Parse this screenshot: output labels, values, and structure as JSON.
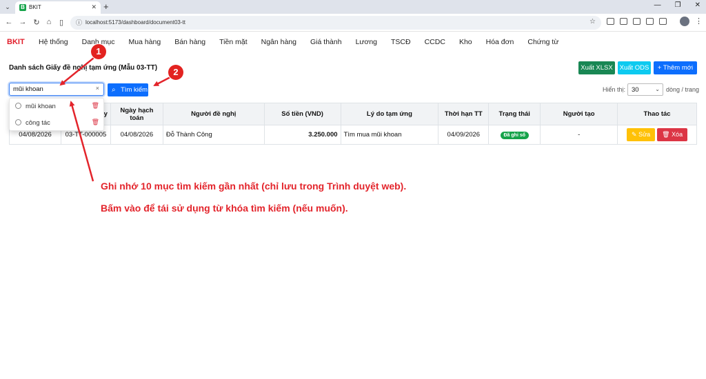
{
  "browser": {
    "tab_title": "BKIT",
    "tab_favicon": "B",
    "url": "localhost:5173/dashboard/document03-tt",
    "icons": [
      "menu-chevron-icon",
      "back-icon",
      "forward-icon",
      "reload-icon",
      "home-icon",
      "sidebar-icon",
      "site-info-icon",
      "star-icon",
      "close-icon",
      "plus-icon",
      "minimize-icon",
      "restore-icon",
      "window-close-icon",
      "kebab-menu-icon"
    ]
  },
  "nav": {
    "brand": "BKIT",
    "items": [
      "Hệ thống",
      "Danh mục",
      "Mua hàng",
      "Bán hàng",
      "Tiền mặt",
      "Ngân hàng",
      "Giá thành",
      "Lương",
      "TSCĐ",
      "CCDC",
      "Kho",
      "Hóa đơn",
      "Chứng từ"
    ]
  },
  "page": {
    "title": "Danh sách Giấy đề nghị tạm ứng (Mẫu 03-TT)",
    "export_xlsx": "Xuất XLSX",
    "export_ods": "Xuất ODS",
    "new_button": "+ Thêm mới"
  },
  "search": {
    "value": "mũi khoan",
    "clear": "×",
    "button": "Tìm kiếm",
    "history": [
      "mũi khoan",
      "công tác"
    ]
  },
  "pagination": {
    "show_label": "Hiển thị:",
    "page_size": "30",
    "per_page_label": "dòng / trang"
  },
  "table": {
    "headers": [
      "Ngày CT",
      "Số CT",
      "Ngày hạch toán",
      "Người đề nghị",
      "Số tiền (VND)",
      "Lý do tạm ứng",
      "Thời hạn TT",
      "Trạng thái",
      "Người tạo",
      "Thao tác"
    ],
    "visible_header_fragments": [
      "y",
      ""
    ],
    "rows": [
      {
        "date": "04/08/2026",
        "number": "03-TT-000005",
        "posting_date": "04/08/2026",
        "requester": "Đỗ Thành Công",
        "amount": "3.250.000",
        "reason": "Tìm mua mũi khoan",
        "due_date": "04/09/2026",
        "status": "Đã ghi sổ",
        "creator": "-",
        "edit": "Sửa",
        "delete": "Xóa"
      }
    ]
  },
  "annotations": {
    "marker_1": "1",
    "marker_2": "2",
    "note_1": "Ghi nhớ 10 mục tìm kiếm gần nhất (chỉ lưu trong Trình duyệt web).",
    "note_2": "Bấm vào để tái sử dụng từ khóa tìm kiếm (nếu muốn).",
    "color": "#e3242b"
  },
  "colors": {
    "brand": "#e11d2a",
    "success": "#198754",
    "info": "#0dcaf0",
    "primary": "#0d6efd",
    "warning": "#ffc107",
    "danger": "#dc3545"
  }
}
